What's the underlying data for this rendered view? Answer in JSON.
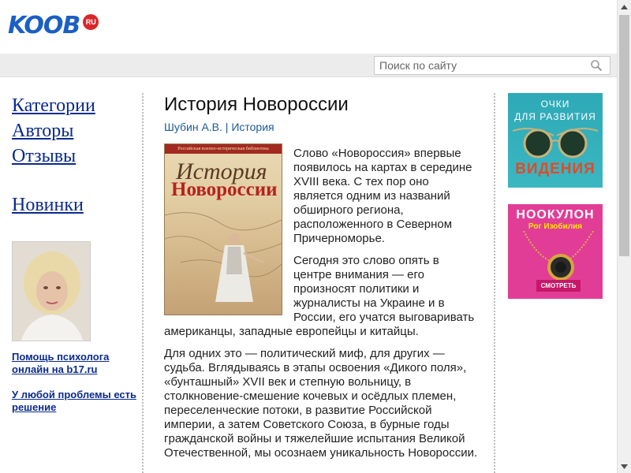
{
  "header": {
    "logo_text": "KOOB",
    "logo_badge": "RU"
  },
  "search": {
    "placeholder": "Поиск по сайту"
  },
  "nav": {
    "categories": "Категории",
    "authors": "Авторы",
    "reviews": "Отзывы",
    "new": "Новинки"
  },
  "sidebar": {
    "link1": "Помощь психолога онлайн на b17.ru",
    "link2": "У любой проблемы есть решение"
  },
  "article": {
    "title": "История Новороссии",
    "author": "Шубин А.В.",
    "separator": " | ",
    "category": "История",
    "cover_band": "Российская военно-историческая библиотека",
    "cover_title1": "История",
    "cover_title2": "Новороссии",
    "paragraphs": [
      "Слово «Новороссия» впервые появилось на картах в середине XVIII века. С тех пор оно является одним из названий обширного региона, расположенного в Северном Причерноморье.",
      "Сегодня это слово опять в центре внимания — его произносят политики и журналисты на Украине и в России, его учатся выговаривать американцы, западные европейцы и китайцы.",
      "Для одних это — политический миф, для других — судьба. Вглядываясь в этапы освоения «Дикого поля», «бунташный» XVII век и степную вольницу, в столкновение-смешение кочевых и осёдлых племен, переселенческие потоки, в развитие Российской империи, а затем Советского Союза, в бурные годы гражданской войны и тяжелейшие испытания Великой Отечественной, мы осознаем уникальность Новороссии."
    ]
  },
  "ads": {
    "ad1_line1": "ОЧКИ",
    "ad1_line2": "ДЛЯ РАЗВИТИЯ",
    "ad1_line3": "ВИДЕНИЯ",
    "ad2_title": "НООКУЛОН",
    "ad2_sub": "Рог Изобилия",
    "ad2_button": "СМОТРЕТЬ"
  }
}
